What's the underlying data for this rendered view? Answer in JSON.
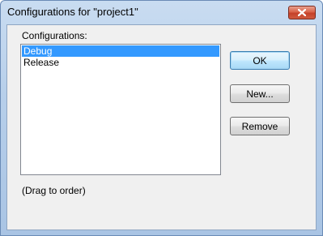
{
  "window": {
    "title": "Configurations for \"project1\""
  },
  "dialog": {
    "configurations_label": "Configurations:",
    "drag_hint": "(Drag to order)",
    "configurations": [
      {
        "label": "Debug",
        "selected": true
      },
      {
        "label": "Release",
        "selected": false
      }
    ]
  },
  "buttons": {
    "ok": "OK",
    "new": "New...",
    "remove": "Remove"
  },
  "icons": {
    "close": "close-icon"
  },
  "colors": {
    "selection": "#3399ff",
    "close_button": "#c5422a",
    "title_gradient": "#b7cfea"
  }
}
